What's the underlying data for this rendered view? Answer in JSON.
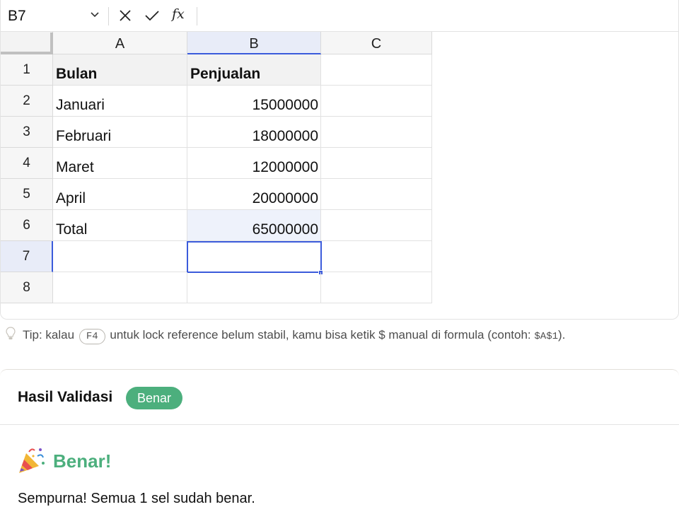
{
  "formula_bar": {
    "cell_reference": "B7",
    "formula_value": "",
    "fx_label": "fx"
  },
  "columns": [
    "A",
    "B",
    "C"
  ],
  "rows": [
    "1",
    "2",
    "3",
    "4",
    "5",
    "6",
    "7",
    "8"
  ],
  "selected_cell": "B7",
  "cells": {
    "A1": "Bulan",
    "B1": "Penjualan",
    "A2": "Januari",
    "B2": "15000000",
    "A3": "Februari",
    "B3": "18000000",
    "A4": "Maret",
    "B4": "12000000",
    "A5": "April",
    "B5": "20000000",
    "A6": "Total",
    "B6": "65000000"
  },
  "tip": {
    "icon": "lightbulb-icon",
    "prefix": "Tip: kalau",
    "key": "F4",
    "middle": "untuk lock reference belum stabil, kamu bisa ketik $ manual di formula (contoh:",
    "example": "$A$1",
    "suffix": ")."
  },
  "result": {
    "title": "Hasil Validasi",
    "badge": "Benar",
    "success_icon": "party-popper-icon",
    "success_title": "Benar!",
    "message": "Sempurna! Semua 1 sel sudah benar."
  },
  "colors": {
    "accent_blue": "#3b5bdb",
    "success_green": "#4caf7d",
    "tip_background": "#f0ece6"
  }
}
